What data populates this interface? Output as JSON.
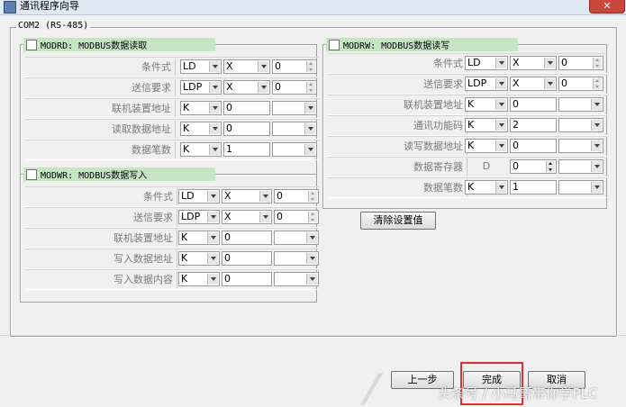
{
  "window": {
    "title": "通讯程序向导",
    "close_label": "✕"
  },
  "group": {
    "label": "COM2 (RS-485)"
  },
  "panels": {
    "modrd": {
      "title": "MODRD: MODBUS数据读取",
      "rows": [
        {
          "label": "条件式",
          "c1": "LD",
          "c2": "X",
          "c3": "0"
        },
        {
          "label": "送信要求",
          "c1": "LDP",
          "c2": "X",
          "c3": "0"
        },
        {
          "label": "联机装置地址",
          "c1": "K",
          "c2": "0",
          "c3": ""
        },
        {
          "label": "读取数据地址",
          "c1": "K",
          "c2": "0",
          "c3": ""
        },
        {
          "label": "数据笔数",
          "c1": "K",
          "c2": "1",
          "c3": ""
        }
      ]
    },
    "modwr": {
      "title": "MODWR: MODBUS数据写入",
      "rows": [
        {
          "label": "条件式",
          "c1": "LD",
          "c2": "X",
          "c3": "0"
        },
        {
          "label": "送信要求",
          "c1": "LDP",
          "c2": "X",
          "c3": "0"
        },
        {
          "label": "联机装置地址",
          "c1": "K",
          "c2": "0",
          "c3": ""
        },
        {
          "label": "写入数据地址",
          "c1": "K",
          "c2": "0",
          "c3": ""
        },
        {
          "label": "写入数据内容",
          "c1": "K",
          "c2": "0",
          "c3": ""
        }
      ]
    },
    "modrw": {
      "title": "MODRW: MODBUS数据读写",
      "rows": [
        {
          "label": "条件式",
          "c1": "LD",
          "c2": "X",
          "c3": "0"
        },
        {
          "label": "送信要求",
          "c1": "LDP",
          "c2": "X",
          "c3": "0"
        },
        {
          "label": "联机装置地址",
          "c1": "K",
          "c2": "0",
          "c3": ""
        },
        {
          "label": "通讯功能码",
          "c1": "K",
          "c2": "2",
          "c3": ""
        },
        {
          "label": "读写数据地址",
          "c1": "K",
          "c2": "0",
          "c3": ""
        },
        {
          "label": "数据寄存器",
          "c1": "D",
          "c2": "0",
          "c3": ""
        },
        {
          "label": "数据笔数",
          "c1": "K",
          "c2": "1",
          "c3": ""
        }
      ]
    }
  },
  "buttons": {
    "clear_settings": "清除设置值",
    "prev": "上一步",
    "finish": "完成",
    "cancel": "取消"
  },
  "watermark": "头条号 / 小马哥带你学PLC"
}
